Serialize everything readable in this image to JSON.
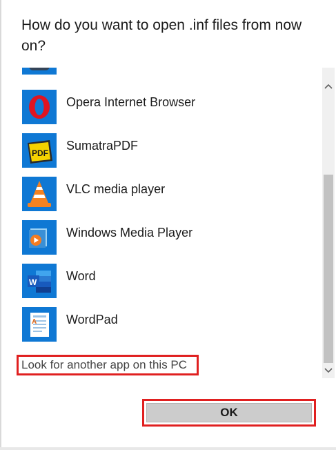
{
  "dialog": {
    "title": "How do you want to open .inf files from now on?"
  },
  "apps": [
    {
      "label": "Opera Internet Browser",
      "icon": "opera-icon"
    },
    {
      "label": "SumatraPDF",
      "icon": "sumatrapdf-icon"
    },
    {
      "label": "VLC media player",
      "icon": "vlc-icon"
    },
    {
      "label": "Windows Media Player",
      "icon": "windows-media-player-icon"
    },
    {
      "label": "Word",
      "icon": "word-icon"
    },
    {
      "label": "WordPad",
      "icon": "wordpad-icon"
    }
  ],
  "look_for_link": "Look for another app on this PC",
  "ok_label": "OK",
  "colors": {
    "tile_blue": "#0f78d4",
    "highlight_red": "#e02020"
  }
}
